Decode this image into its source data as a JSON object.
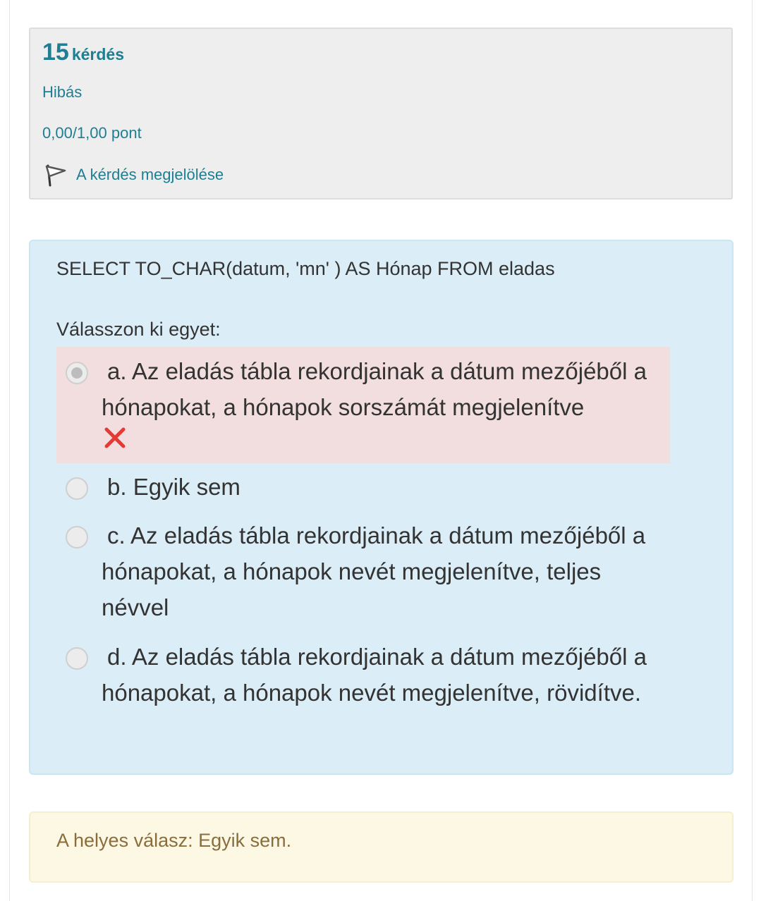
{
  "question_info": {
    "number": "15",
    "word": "kérdés",
    "state": "Hibás",
    "grade": "0,00/1,00 pont",
    "flag_label": "A kérdés megjelölése"
  },
  "question": {
    "text": "SELECT TO_CHAR(datum, 'mn' ) AS Hónap FROM eladas",
    "prompt": "Válasszon ki egyet:",
    "answers": [
      {
        "letter": "a.",
        "text": "Az eladás tábla rekordjainak a dátum mezőjéből a hónapokat, a hónapok sorszámát megjelenítve",
        "selected": true,
        "incorrect": true
      },
      {
        "letter": "b.",
        "text": "Egyik sem",
        "selected": false
      },
      {
        "letter": "c.",
        "text": "Az eladás tábla rekordjainak a dátum mezőjéből a hónapokat, a hónapok nevét megjelenítve, teljes névvel",
        "selected": false
      },
      {
        "letter": "d.",
        "text": "Az eladás tábla rekordjainak a dátum mezőjéből a hónapokat, a hónapok nevét megjelenítve, rövidítve.",
        "selected": false
      }
    ]
  },
  "feedback": {
    "right_answer": "A helyes válasz: Egyik sem."
  },
  "icons": {
    "flag": "flag-icon",
    "incorrect": "incorrect-x-icon"
  },
  "colors": {
    "link": "#1f7e91",
    "question_bg": "#dbedf6",
    "incorrect_bg": "#f2dede",
    "incorrect_mark": "#e53935",
    "feedback_bg": "#fcf8e3",
    "feedback_text": "#8a6d3b"
  }
}
